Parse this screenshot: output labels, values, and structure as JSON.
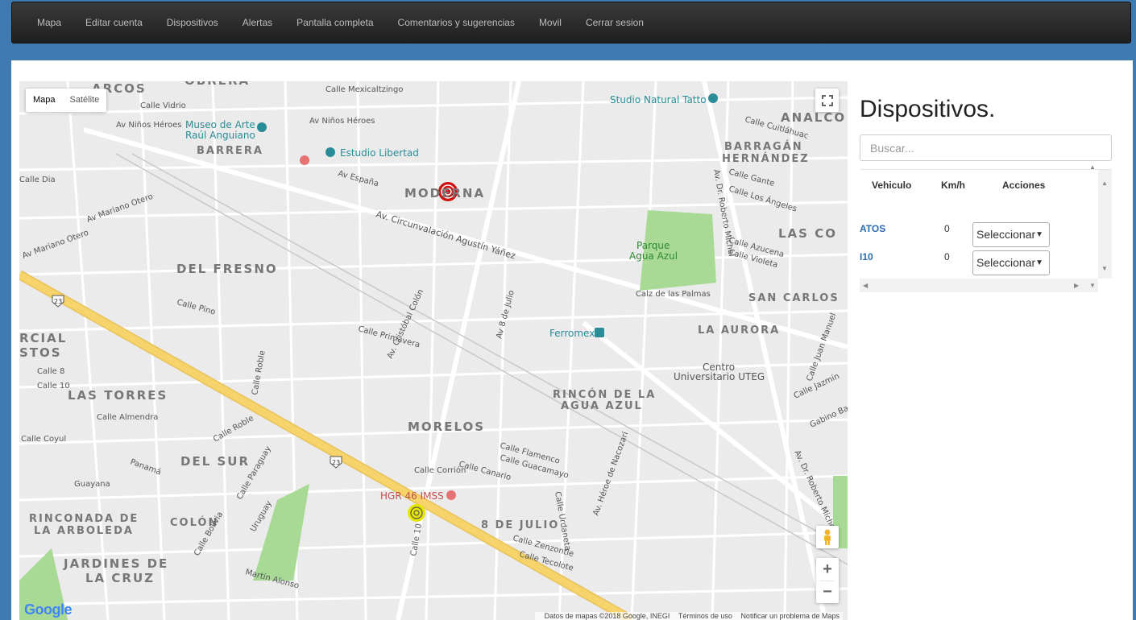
{
  "nav": {
    "items": [
      "Mapa",
      "Editar cuenta",
      "Dispositivos",
      "Alertas",
      "Pantalla completa",
      "Comentarios y sugerencias",
      "Movil",
      "Cerrar sesion"
    ]
  },
  "map": {
    "type_buttons": {
      "map": "Mapa",
      "satellite": "Satélite"
    },
    "footer": {
      "data": "Datos de mapas ©2018 Google, INEGI",
      "terms": "Términos de uso",
      "report": "Notificar un problema de Maps"
    },
    "logo": "Google",
    "zoom_in": "+",
    "zoom_out": "−",
    "districts": [
      "ARCOS",
      "OBRERA",
      "MODERNA",
      "BARRERA",
      "ANALCO",
      "BARRAGÁN",
      "HERNÁNDEZ",
      "DEL FRESNO",
      "LAS CO",
      "SAN CARLOS",
      "LA AURORA",
      "RCIAL",
      "STOS",
      "LAS TORRES",
      "MORELOS",
      "RINCÓN DE LA",
      "AGUA AZUL",
      "DEL SUR",
      "RINCONADA DE",
      "LA ARBOLEDA",
      "COLÓN",
      "8 DE JULIO",
      "JARDINES DE",
      "LA CRUZ"
    ],
    "places": [
      "Museo de Arte",
      "Raúl Anguiano",
      "Estudio Libertad",
      "Studio Natural Tatto",
      "Parque",
      "Agua Azul",
      "Ferromex",
      "Centro",
      "Universitario UTEG",
      "HGR 46 IMSS"
    ],
    "streets": [
      "Av Niños Héroes",
      "Av Niños Héroes",
      "Av Mariano Otero",
      "Av Mariano Otero",
      "Av. Circunvalación Agustín Yáñez",
      "Calle Los Ángeles",
      "Av. Dr. Roberto Michel",
      "Av. Dr. Roberto Michel",
      "Av. Cristóbal Colón",
      "Av 8 de Julio",
      "Av. Héroe de Nacozari",
      "Calle Roble",
      "Calle 10",
      "Calle Vidrio",
      "Calle Mexicaltzingo",
      "Av España",
      "Calle Dia",
      "Calle Primavera",
      "Calle Cuitláhuac",
      "Calle Gante",
      "Calle Azucena",
      "Calle Violeta",
      "Calz de las Palmas",
      "Calle Pino",
      "Calle Almendra",
      "Calle Coyul",
      "Calle 8",
      "Calle 10",
      "Calle Flamenco",
      "Calle Guacamayo",
      "Calle Canario",
      "Calle Corrión",
      "Calle Urdaneta",
      "Calle Zenzontle",
      "Calle Tecolote",
      "Martín Alonso",
      "Calle Bolivia",
      "Uruguay",
      "Calle Paraguay",
      "Guayana",
      "Panamá",
      "Calle Roble",
      "Calle Juan Manuel",
      "Calle Jazmín",
      "Gabino Barreda"
    ]
  },
  "sidebar": {
    "title": "Dispositivos.",
    "search_placeholder": "Buscar...",
    "headers": {
      "vehicle": "Vehiculo",
      "speed": "Km/h",
      "actions": "Acciones"
    },
    "rows": [
      {
        "name": "ATOS",
        "speed": "0",
        "action": "Seleccionar"
      },
      {
        "name": "I10",
        "speed": "0",
        "action": "Seleccionar"
      }
    ]
  },
  "colors": {
    "navbar": "#2c2c2c",
    "accent": "#3f7ab0",
    "highway": "#f7d46b",
    "park": "#a8da95",
    "marker_red": "#d01010",
    "marker_yellow": "#e6e600"
  }
}
